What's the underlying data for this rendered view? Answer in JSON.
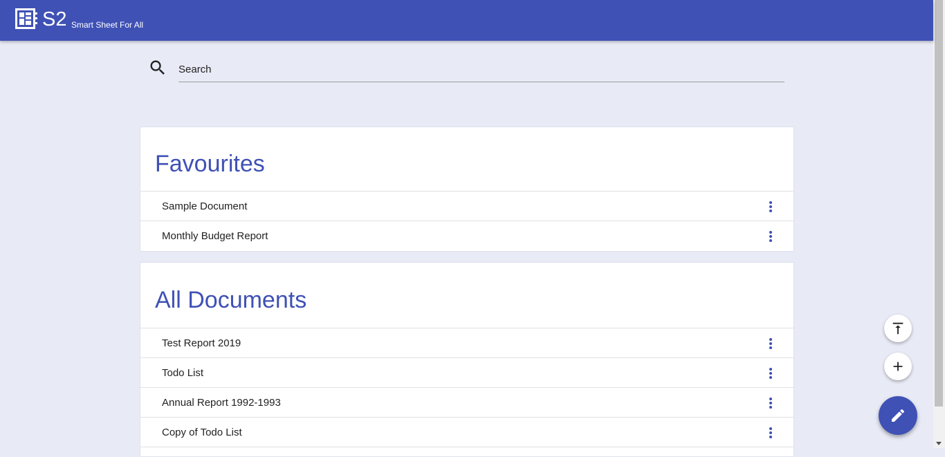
{
  "app": {
    "brand": "S2",
    "tagline": "Smart Sheet For All",
    "logo_icon": "spreadsheet-logo-icon",
    "accent_color": "#3f51b5",
    "background_color": "#e8eaf6"
  },
  "search": {
    "placeholder": "Search",
    "value": "",
    "icon": "search-icon"
  },
  "favourites": {
    "title": "Favourites",
    "items": [
      {
        "label": "Sample Document",
        "menu_icon": "more-vert-icon"
      },
      {
        "label": "Monthly Budget Report",
        "menu_icon": "more-vert-icon"
      }
    ]
  },
  "all_documents": {
    "title": "All Documents",
    "items": [
      {
        "label": "Test Report 2019",
        "menu_icon": "more-vert-icon"
      },
      {
        "label": "Todo List",
        "menu_icon": "more-vert-icon"
      },
      {
        "label": "Annual Report 1992-1993",
        "menu_icon": "more-vert-icon"
      },
      {
        "label": "Copy of Todo List",
        "menu_icon": "more-vert-icon"
      }
    ]
  },
  "actions": {
    "scroll_top_icon": "vertical-align-top-icon",
    "add_icon": "add-icon",
    "edit_icon": "edit-pencil-icon"
  }
}
